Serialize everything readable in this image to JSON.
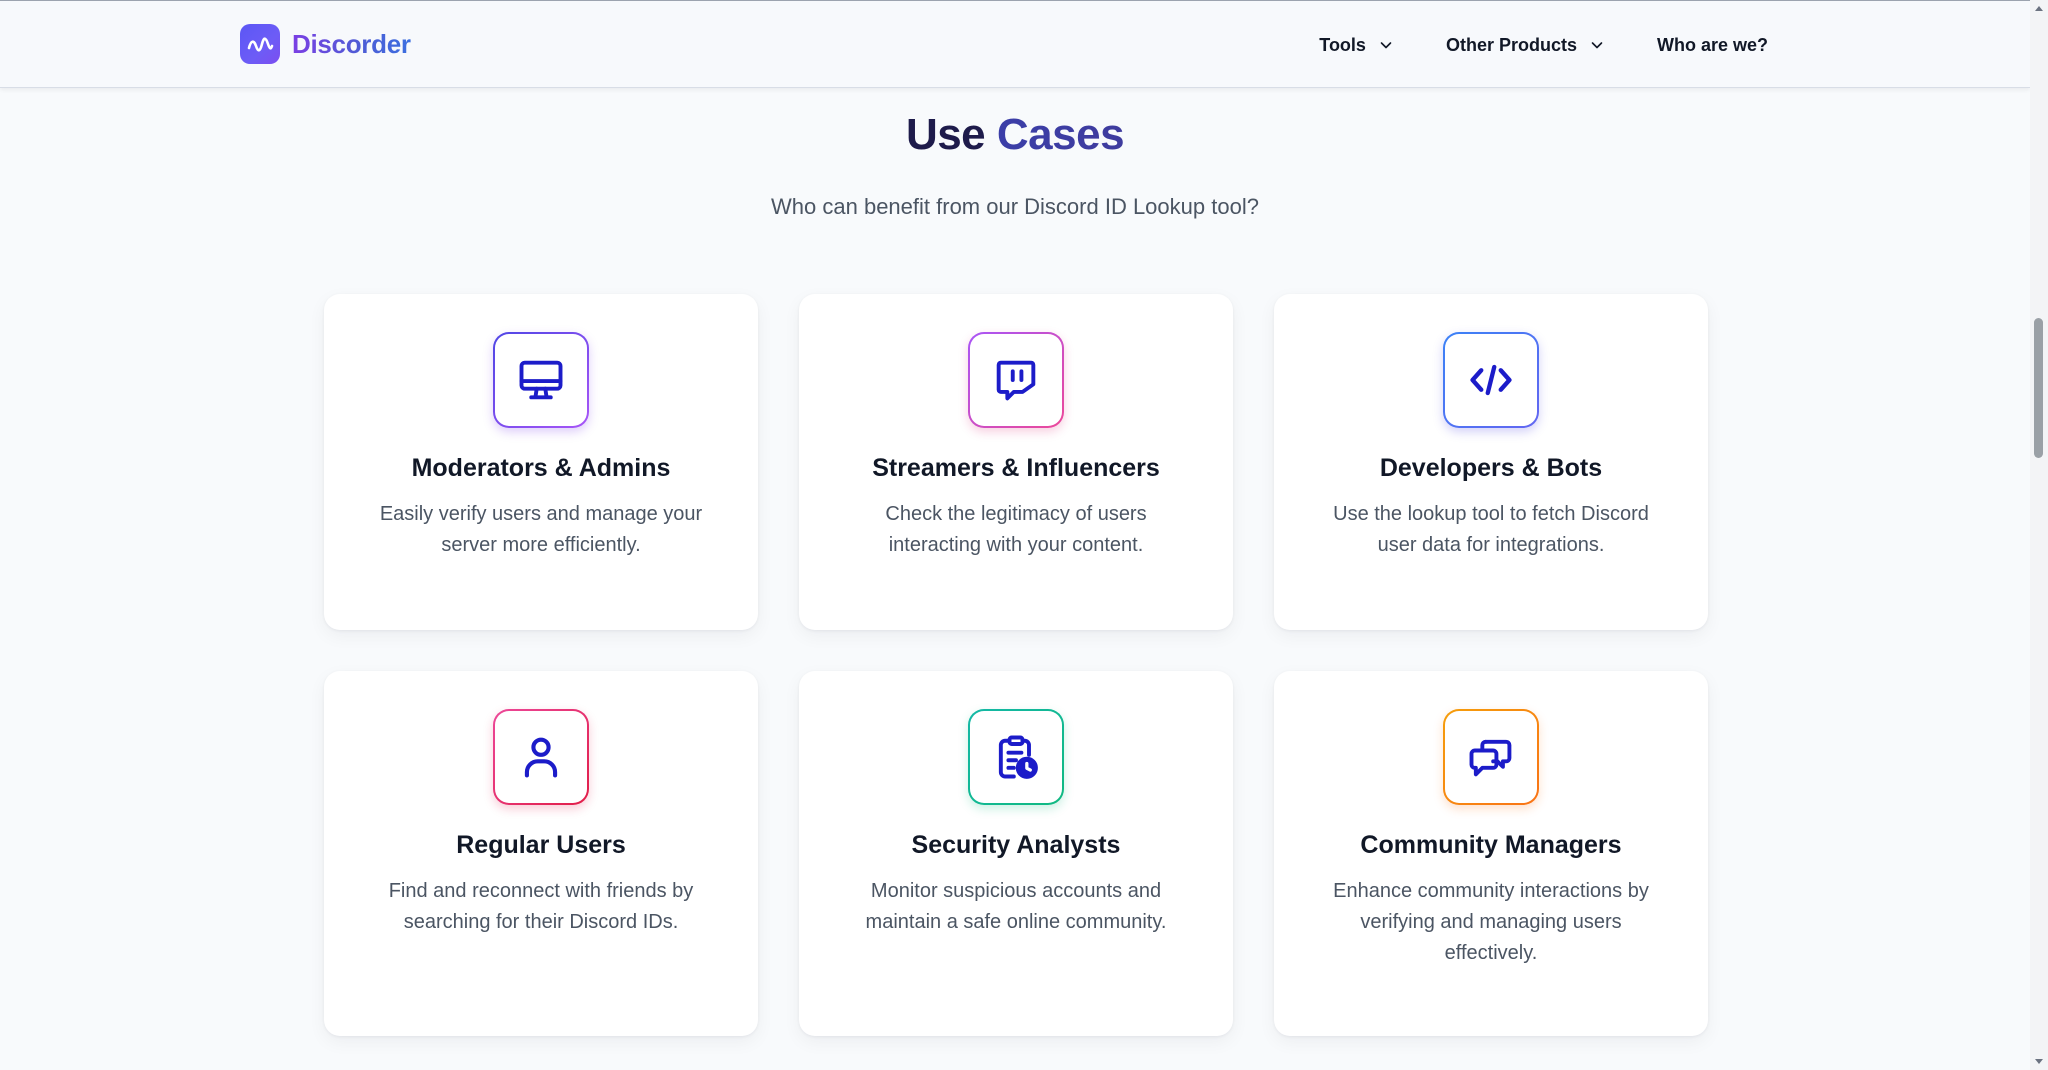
{
  "colors": {
    "icon_stroke": "#1c1cc9",
    "heading": "#1e1b4b",
    "heading_accent": "#3b3ea8",
    "body_text": "#4b5563"
  },
  "header": {
    "brand": "Discorder",
    "logo_icon": "wave-icon",
    "nav": [
      {
        "label": "Tools",
        "has_dropdown": true
      },
      {
        "label": "Other Products",
        "has_dropdown": true
      },
      {
        "label": "Who are we?",
        "has_dropdown": false
      }
    ]
  },
  "section": {
    "title_part1": "Use",
    "title_part2": "Cases",
    "subtitle": "Who can benefit from our Discord ID Lookup tool?"
  },
  "cards": [
    {
      "icon": "monitor-icon",
      "title": "Moderators & Admins",
      "desc": "Easily verify users and manage your server more efficiently."
    },
    {
      "icon": "twitch-icon",
      "title": "Streamers & Influencers",
      "desc": "Check the legitimacy of users interacting with your content."
    },
    {
      "icon": "code-icon",
      "title": "Developers & Bots",
      "desc": "Use the lookup tool to fetch Discord user data for integrations."
    },
    {
      "icon": "user-icon",
      "title": "Regular Users",
      "desc": "Find and reconnect with friends by searching for their Discord IDs."
    },
    {
      "icon": "clipboard-clock-icon",
      "title": "Security Analysts",
      "desc": "Monitor suspicious accounts and maintain a safe online community."
    },
    {
      "icon": "chat-bubbles-icon",
      "title": "Community Managers",
      "desc": "Enhance community interactions by verifying and managing users effectively."
    }
  ]
}
